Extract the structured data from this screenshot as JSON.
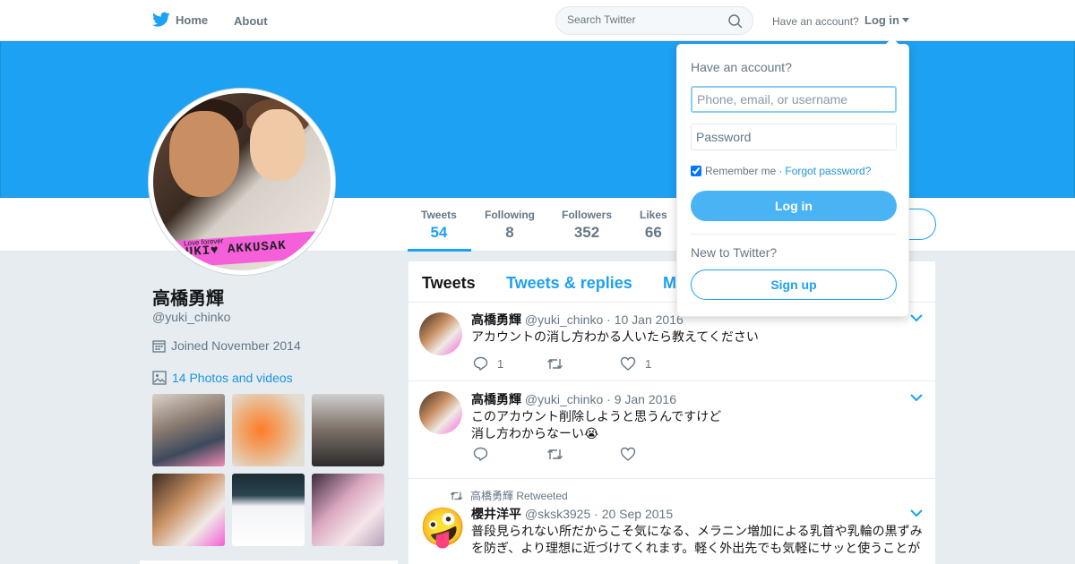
{
  "nav": {
    "home_label": "Home",
    "about_label": "About",
    "search_placeholder": "Search Twitter",
    "have_account": "Have an account?",
    "login_label": "Log in"
  },
  "profile": {
    "display_name": "高橋勇輝",
    "handle": "@yuki_chinko",
    "joined": "Joined November 2014",
    "photos_label": "14 Photos and videos",
    "avatar_caption": "Love forever",
    "avatar_strip_text": "UKI♥ AKKUSAK"
  },
  "stats": [
    {
      "label": "Tweets",
      "value": "54"
    },
    {
      "label": "Following",
      "value": "8"
    },
    {
      "label": "Followers",
      "value": "352"
    },
    {
      "label": "Likes",
      "value": "66"
    }
  ],
  "timeline": {
    "tabs": [
      "Tweets",
      "Tweets & replies",
      "M"
    ],
    "tweets": [
      {
        "name": "高橋勇輝",
        "handle": "@yuki_chinko",
        "date": "10 Jan 2016",
        "text_lines": [
          "アカウントの消し方わかる人いたら教えてください"
        ],
        "replies": "1",
        "retweets": "",
        "likes": "1"
      },
      {
        "name": "高橋勇輝",
        "handle": "@yuki_chinko",
        "date": "9 Jan 2016",
        "text_lines": [
          "このアカウント削除しようと思うんですけど",
          "消し方わからなーい😭"
        ],
        "replies": "",
        "retweets": "",
        "likes": ""
      },
      {
        "retweet_context": "高橋勇輝 Retweeted",
        "name": "櫻井洋平",
        "handle": "@sksk3925",
        "date": "20 Sep 2015",
        "text_lines": [
          "普段見られない所だからこそ気になる、メラニン増加による乳首や乳輪の黒ずみ",
          "を防ぎ、より理想に近づけてくれます。軽く外出先でも気軽にサッと使うことが"
        ],
        "avatar_emoji": "🤪"
      }
    ]
  },
  "login_dropdown": {
    "title": "Have an account?",
    "username_placeholder": "Phone, email, or username",
    "password_placeholder": "Password",
    "remember_label": "Remember me",
    "separator": "·",
    "forgot_label": "Forgot password?",
    "login_button": "Log in",
    "new_to_twitter": "New to Twitter?",
    "signup_button": "Sign up"
  },
  "colors": {
    "brand_blue": "#1da1f2",
    "banner": "#1da1f2",
    "link": "#1b95e0",
    "page_bg": "#e6ecf0"
  },
  "icons": [
    "twitter-bird-icon",
    "search-icon",
    "calendar-icon",
    "photo-icon",
    "reply-icon",
    "retweet-icon",
    "heart-icon",
    "chevron-down-icon"
  ]
}
